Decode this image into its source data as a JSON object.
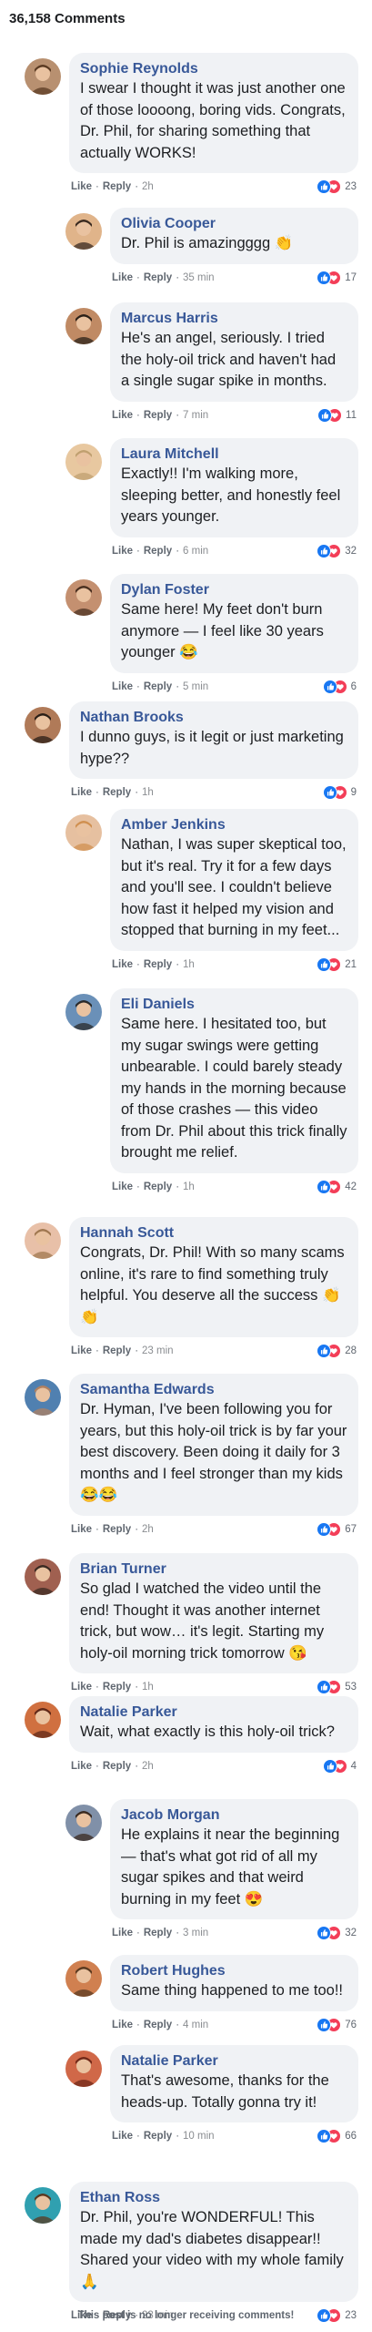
{
  "header": {
    "count_label": "36,158 Comments"
  },
  "meta_labels": {
    "like": "Like",
    "reply": "Reply",
    "sep": "·"
  },
  "comments": [
    {
      "name": "Sophie Reynolds",
      "text": "I swear I thought it was just another one of those loooong, boring vids. Congrats, Dr. Phil, for sharing something that actually WORKS!",
      "time": "2h",
      "reactions": "23",
      "level": "top"
    },
    {
      "name": "Olivia Cooper",
      "text": "Dr. Phil is amazingggg 👏",
      "time": "35 min",
      "reactions": "17",
      "level": "reply"
    },
    {
      "name": "Marcus Harris",
      "text": "He's an angel, seriously. I tried the holy-oil trick and haven't had a single sugar spike in months.",
      "time": "7 min",
      "reactions": "11",
      "level": "reply"
    },
    {
      "name": "Laura Mitchell",
      "text": "Exactly!! I'm walking more, sleeping better, and honestly feel years younger.",
      "time": "6 min",
      "reactions": "32",
      "level": "reply"
    },
    {
      "name": "Dylan Foster",
      "text": "Same here! My feet don't burn anymore — I feel like 30 years younger 😂",
      "time": "5 min",
      "reactions": "6",
      "level": "reply"
    },
    {
      "name": "Nathan Brooks",
      "text": "I dunno guys, is it legit or just marketing hype??",
      "time": "1h",
      "reactions": "9",
      "level": "top"
    },
    {
      "name": "Amber Jenkins",
      "text": "Nathan, I was super skeptical too, but it's real. Try it for a few days and you'll see. I couldn't believe how fast it helped my vision and stopped that burning in my feet...",
      "time": "1h",
      "reactions": "21",
      "level": "reply"
    },
    {
      "name": "Eli Daniels",
      "text": "Same here. I hesitated too, but my sugar swings were getting unbearable. I could barely steady my hands in the morning because of those crashes — this video from Dr. Phil about this trick finally brought me relief.",
      "time": "1h",
      "reactions": "42",
      "level": "reply"
    },
    {
      "name": "Hannah Scott",
      "text": "Congrats, Dr. Phil! With so many scams online, it's rare to find something truly helpful. You deserve all the success 👏👏",
      "time": "23 min",
      "reactions": "28",
      "level": "top"
    },
    {
      "name": "Samantha Edwards",
      "text": "Dr. Hyman, I've been following you for years, but this holy-oil trick is by far your best discovery. Been doing it daily for 3 months and I feel stronger than my kids 😂😂",
      "time": "2h",
      "reactions": "67",
      "level": "top"
    },
    {
      "name": "Brian Turner",
      "text": "So glad I watched the video until the end! Thought it was another internet trick, but wow… it's legit. Starting my holy-oil morning trick tomorrow 😘",
      "time": "1h",
      "reactions": "53",
      "level": "top"
    },
    {
      "name": "Natalie Parker",
      "text": "Wait, what exactly is this holy-oil trick?",
      "time": "2h",
      "reactions": "4",
      "level": "top"
    },
    {
      "name": "Jacob Morgan",
      "text": "He explains it near the beginning — that's what got rid of all my sugar spikes and that weird burning in my feet 😍",
      "time": "3 min",
      "reactions": "32",
      "level": "reply"
    },
    {
      "name": "Robert Hughes",
      "text": "Same thing happened to me too!!",
      "time": "4 min",
      "reactions": "76",
      "level": "reply"
    },
    {
      "name": "Natalie Parker",
      "text": "That's awesome, thanks for the heads-up. Totally gonna try it!",
      "time": "10 min",
      "reactions": "66",
      "level": "reply"
    },
    {
      "name": "Ethan Ross",
      "text": "Dr. Phil, you're WONDERFUL! This made my dad's diabetes disappear!! Shared your video with my whole family 🙏",
      "time": "23 min",
      "reactions": "23",
      "level": "top"
    }
  ],
  "footer": {
    "text": "This post is no longer receiving comments!"
  },
  "colors": {
    "name": "#385898",
    "bubble": "#f0f2f5",
    "like": "#1877f2",
    "love": "#f33e58"
  }
}
